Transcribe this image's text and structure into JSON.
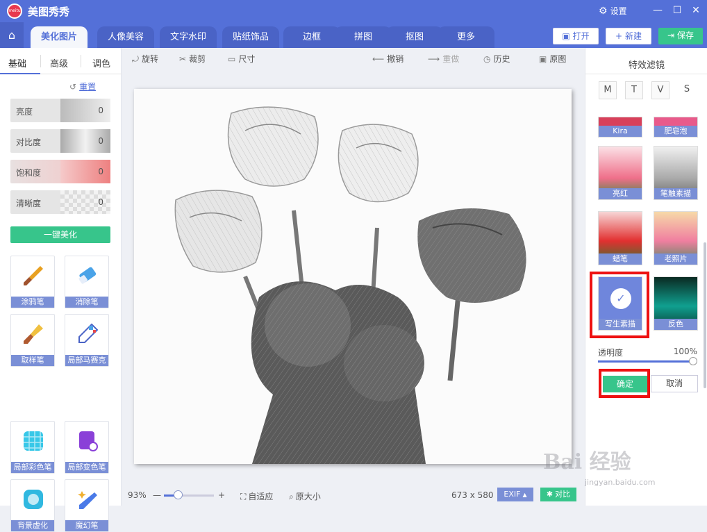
{
  "app": {
    "title": "美图秀秀",
    "logo_text": "meitu",
    "settings_label": "设置"
  },
  "tabs": [
    {
      "label": "美化图片",
      "active": true
    },
    {
      "label": "人像美容"
    },
    {
      "label": "文字水印"
    },
    {
      "label": "贴纸饰品"
    },
    {
      "label": "边框"
    },
    {
      "label": "拼图"
    },
    {
      "label": "抠图"
    },
    {
      "label": "更多"
    }
  ],
  "top_actions": {
    "open": "打开",
    "new": "新建",
    "save": "保存"
  },
  "left": {
    "subtabs": [
      "基础",
      "高级",
      "调色"
    ],
    "reset": "重置",
    "sliders": [
      {
        "label": "亮度",
        "value": "0"
      },
      {
        "label": "对比度",
        "value": "0"
      },
      {
        "label": "饱和度",
        "value": "0"
      },
      {
        "label": "清晰度",
        "value": "0"
      }
    ],
    "one_click": "一键美化",
    "tools": [
      "涂鸦笔",
      "消除笔",
      "取样笔",
      "局部马赛克",
      "局部彩色笔",
      "局部变色笔",
      "背景虚化",
      "魔幻笔"
    ]
  },
  "toolbar": {
    "rotate": "旋转",
    "crop": "裁剪",
    "size": "尺寸",
    "undo": "撤销",
    "redo": "重做",
    "history": "历史",
    "original": "原图"
  },
  "bottom": {
    "zoom": "93%",
    "zoom_value": 0.25,
    "fit": "自适应",
    "actual": "原大小",
    "dimensions": "673 x 580",
    "exif": "EXIF",
    "compare": "对比"
  },
  "right": {
    "title": "特效滤镜",
    "categories": [
      "M",
      "T",
      "V",
      "S"
    ],
    "filters": [
      {
        "label": "Kira"
      },
      {
        "label": "肥皂泡"
      },
      {
        "label": "亮红"
      },
      {
        "label": "笔触素描"
      },
      {
        "label": "蜡笔"
      },
      {
        "label": "老照片"
      },
      {
        "label": "写生素描",
        "selected": true
      },
      {
        "label": "反色"
      }
    ],
    "opacity_label": "透明度",
    "opacity_value": "100%",
    "ok": "确定",
    "cancel": "取消"
  },
  "watermark": {
    "text": "Bai 经验",
    "sub": "jingyan.baidu.com"
  },
  "colors": {
    "accent": "#5470d8",
    "green": "#37c58b",
    "highlight": "#e11111",
    "label_bg": "#7a8fd6"
  }
}
